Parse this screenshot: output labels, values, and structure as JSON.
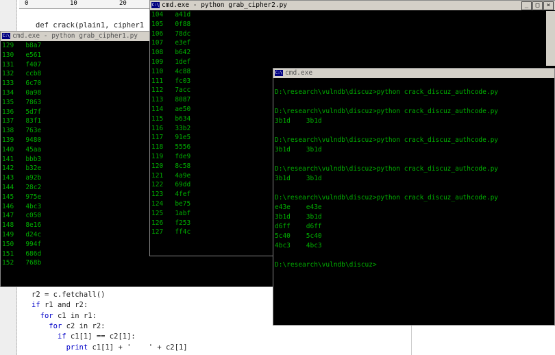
{
  "editor": {
    "ruler_ticks": [
      "0",
      "10",
      "20"
    ],
    "def_line": "def crack(plain1, cipher1",
    "code_lines": [
      {
        "indent": "",
        "text": "r2 = c.fetchall()"
      },
      {
        "indent": "",
        "kw": "if",
        "text": " r1 and r2:"
      },
      {
        "indent": "  ",
        "kw": "for",
        "text": " c1 in r1:"
      },
      {
        "indent": "    ",
        "kw": "for",
        "text": " c2 in r2:"
      },
      {
        "indent": "      ",
        "kw": "if",
        "text": " c1[1] == c2[1]:"
      },
      {
        "indent": "        ",
        "kw": "print",
        "text": " c1[1] + '    ' + c2[1]"
      }
    ]
  },
  "win_cipher1": {
    "title": "cmd.exe - python grab_cipher1.py",
    "lines": [
      "129   b8a7",
      "130   e561",
      "131   f407",
      "132   ccb8",
      "133   6c70",
      "134   0a98",
      "135   7863",
      "136   5d7f",
      "137   83f1",
      "138   763e",
      "139   9480",
      "140   45aa",
      "141   bbb3",
      "142   b32e",
      "143   a92b",
      "144   28c2",
      "145   975e",
      "146   4bc3",
      "147   c050",
      "148   8e16",
      "149   d24c",
      "150   994f",
      "151   686d",
      "152   768b"
    ]
  },
  "win_cipher2": {
    "title": "cmd.exe - python grab_cipher2.py",
    "lines": [
      "104   a41d",
      "105   0f88",
      "106   78dc",
      "107   e3ef",
      "108   b642",
      "109   1def",
      "110   4c88",
      "111   fc03",
      "112   7acc",
      "113   8087",
      "114   ae50",
      "115   b634",
      "116   33b2",
      "117   91e5",
      "118   5556",
      "119   fde9",
      "120   8c58",
      "121   4a9e",
      "122   69dd",
      "123   4fef",
      "124   be75",
      "125   1abf",
      "126   f253",
      "127   ff4c"
    ]
  },
  "win_crack": {
    "title": "cmd.exe",
    "lines": [
      "",
      "D:\\research\\vulndb\\discuz>python crack_discuz_authcode.py",
      "",
      "D:\\research\\vulndb\\discuz>python crack_discuz_authcode.py",
      "3b1d    3b1d",
      "",
      "D:\\research\\vulndb\\discuz>python crack_discuz_authcode.py",
      "3b1d    3b1d",
      "",
      "D:\\research\\vulndb\\discuz>python crack_discuz_authcode.py",
      "3b1d    3b1d",
      "",
      "D:\\research\\vulndb\\discuz>python crack_discuz_authcode.py",
      "e43e    e43e",
      "3b1d    3b1d",
      "d6ff    d6ff",
      "5c40    5c40",
      "4bc3    4bc3",
      "",
      "D:\\research\\vulndb\\discuz>"
    ]
  },
  "window_controls": {
    "min": "_",
    "max": "□",
    "close": "×"
  },
  "console_icon_label": "C:\\",
  "colors": {
    "console_text": "#00b000",
    "console_bg": "#000000",
    "titlebar": "#d4d0c8"
  }
}
